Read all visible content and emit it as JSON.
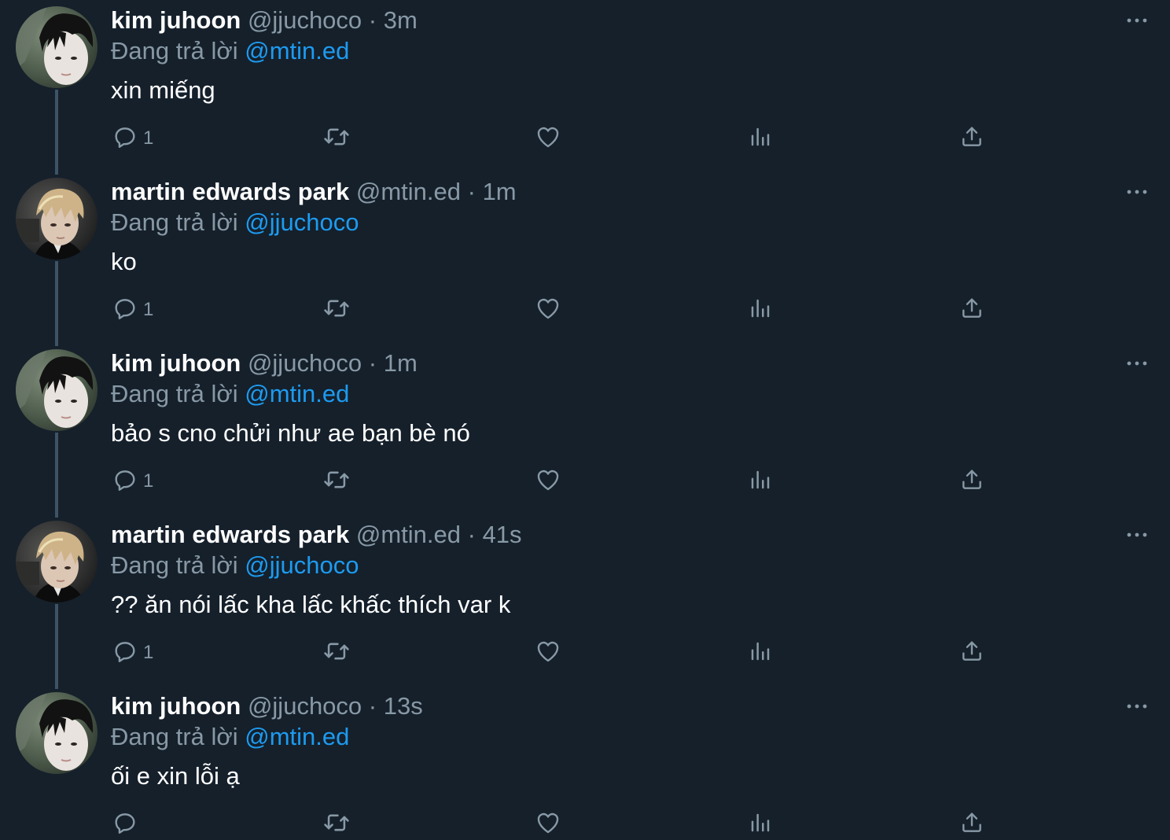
{
  "colors": {
    "background": "#15202b",
    "text_primary": "#ffffff",
    "text_secondary": "#8899a6",
    "mention": "#1d9bf0",
    "thread_line": "#3d5466"
  },
  "icons": {
    "reply": "comment-icon",
    "retweet": "retweet-icon",
    "like": "heart-icon",
    "analytics": "analytics-icon",
    "share": "share-icon",
    "more": "more-icon"
  },
  "tweets": [
    {
      "name": "kim juhoon",
      "handle": "@jjuchoco",
      "separator": "·",
      "time": "3m",
      "reply_prefix": "Đang trả lời",
      "reply_to": "@mtin.ed",
      "text": "xin miếng",
      "reply_count": "1"
    },
    {
      "name": "martin edwards park",
      "handle": "@mtin.ed",
      "separator": "·",
      "time": "1m",
      "reply_prefix": "Đang trả lời",
      "reply_to": "@jjuchoco",
      "text": "ko",
      "reply_count": "1"
    },
    {
      "name": "kim juhoon",
      "handle": "@jjuchoco",
      "separator": "·",
      "time": "1m",
      "reply_prefix": "Đang trả lời",
      "reply_to": "@mtin.ed",
      "text": "bảo s cno chửi như ae bạn bè nó",
      "reply_count": "1"
    },
    {
      "name": "martin edwards park",
      "handle": "@mtin.ed",
      "separator": "·",
      "time": "41s",
      "reply_prefix": "Đang trả lời",
      "reply_to": "@jjuchoco",
      "text": "?? ăn nói lấc kha lấc khấc thích var k",
      "reply_count": "1"
    },
    {
      "name": "kim juhoon",
      "handle": "@jjuchoco",
      "separator": "·",
      "time": "13s",
      "reply_prefix": "Đang trả lời",
      "reply_to": "@mtin.ed",
      "text": "ối e xin lỗi ạ",
      "reply_count": ""
    }
  ]
}
